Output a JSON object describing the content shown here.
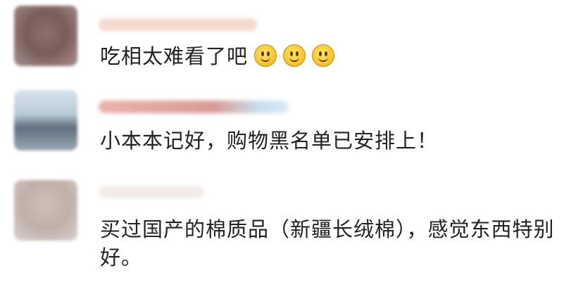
{
  "comments": [
    {
      "text": "吃相太难看了吧",
      "emoji_icons": [
        "smile-emoji-icon",
        "smile-emoji-icon",
        "smile-emoji-icon"
      ],
      "avatar_color": "#7a5d5a"
    },
    {
      "text": "小本本记好，购物黑名单已安排上！",
      "avatar_color": "#5f6f7d"
    },
    {
      "text": "买过国产的棉质品（新疆长绒棉），感觉东西特别好。",
      "avatar_color": "#bfb0a9"
    }
  ]
}
